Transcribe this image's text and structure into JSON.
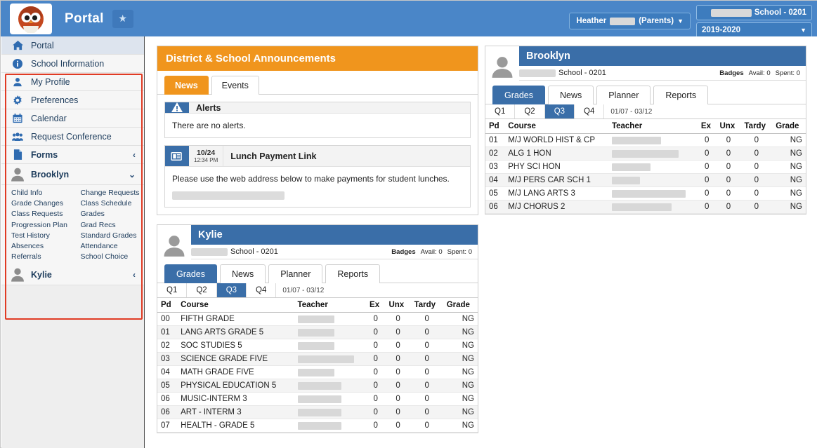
{
  "header": {
    "app_title": "Portal",
    "star_icon": "star-icon",
    "logo_icon": "owl-logo",
    "user_name": "Heather",
    "user_role": "(Parents)",
    "school": "School - 0201",
    "year": "2019-2020",
    "caret": "▼"
  },
  "sidebar": {
    "items": [
      {
        "label": "Portal",
        "icon": "home-icon",
        "active": true
      },
      {
        "label": "School Information",
        "icon": "info-icon",
        "active": false
      },
      {
        "label": "My Profile",
        "icon": "person-icon",
        "active": false
      },
      {
        "label": "Preferences",
        "icon": "gear-icon",
        "active": false
      },
      {
        "label": "Calendar",
        "icon": "calendar-icon",
        "active": false
      },
      {
        "label": "Request Conference",
        "icon": "group-icon",
        "active": false
      },
      {
        "label": "Forms",
        "icon": "document-icon",
        "chevron": "‹"
      }
    ],
    "students": [
      {
        "label": "Brooklyn",
        "icon": "avatar-icon",
        "chevron": "⌄",
        "expanded": true
      },
      {
        "label": "Kylie",
        "icon": "avatar-icon",
        "chevron": "‹",
        "expanded": false
      }
    ],
    "submenu": [
      "Child Info",
      "Change Requests",
      "Grade Changes",
      "Class Schedule",
      "Class Requests",
      "Grades",
      "Progression Plan",
      "Grad Recs",
      "Test History",
      "Standard Grades",
      "Absences",
      "Attendance",
      "Referrals",
      "School Choice"
    ]
  },
  "announcements": {
    "title": "District & School Announcements",
    "tabs": [
      {
        "label": "News",
        "active": true
      },
      {
        "label": "Events",
        "active": false
      }
    ],
    "alerts": {
      "icon": "warning-icon",
      "title": "Alerts",
      "body": "There are no alerts."
    },
    "news_item": {
      "icon": "newspaper-icon",
      "date": "10/24",
      "time": "12:34 PM",
      "title": "Lunch Payment Link",
      "body": "Please use the web address below to make payments for student lunches."
    }
  },
  "students": [
    {
      "name": "Brooklyn",
      "school": "School - 0201",
      "badges_label": "Badges",
      "badges_avail": "Avail: 0",
      "badges_spent": "Spent: 0",
      "tabs": [
        {
          "label": "Grades",
          "active": true
        },
        {
          "label": "News",
          "active": false
        },
        {
          "label": "Planner",
          "active": false
        },
        {
          "label": "Reports",
          "active": false
        }
      ],
      "quarters": [
        {
          "label": "Q1",
          "active": false
        },
        {
          "label": "Q2",
          "active": false
        },
        {
          "label": "Q3",
          "active": true
        },
        {
          "label": "Q4",
          "active": false
        }
      ],
      "date_range": "01/07 - 03/12",
      "columns": [
        "Pd",
        "Course",
        "Teacher",
        "Ex",
        "Unx",
        "Tardy",
        "Grade"
      ],
      "rows": [
        {
          "pd": "01",
          "course": "M/J WORLD HIST & CP",
          "ex": "0",
          "unx": "0",
          "tardy": "0",
          "grade": "NG"
        },
        {
          "pd": "02",
          "course": "ALG 1 HON",
          "ex": "0",
          "unx": "0",
          "tardy": "0",
          "grade": "NG"
        },
        {
          "pd": "03",
          "course": "PHY SCI HON",
          "ex": "0",
          "unx": "0",
          "tardy": "0",
          "grade": "NG"
        },
        {
          "pd": "04",
          "course": "M/J PERS CAR SCH 1",
          "ex": "0",
          "unx": "0",
          "tardy": "0",
          "grade": "NG"
        },
        {
          "pd": "05",
          "course": "M/J LANG ARTS 3",
          "ex": "0",
          "unx": "0",
          "tardy": "0",
          "grade": "NG"
        },
        {
          "pd": "06",
          "course": "M/J CHORUS 2",
          "ex": "0",
          "unx": "0",
          "tardy": "0",
          "grade": "NG"
        }
      ]
    },
    {
      "name": "Kylie",
      "school": "School - 0201",
      "badges_label": "Badges",
      "badges_avail": "Avail: 0",
      "badges_spent": "Spent: 0",
      "tabs": [
        {
          "label": "Grades",
          "active": true
        },
        {
          "label": "News",
          "active": false
        },
        {
          "label": "Planner",
          "active": false
        },
        {
          "label": "Reports",
          "active": false
        }
      ],
      "quarters": [
        {
          "label": "Q1",
          "active": false
        },
        {
          "label": "Q2",
          "active": false
        },
        {
          "label": "Q3",
          "active": true
        },
        {
          "label": "Q4",
          "active": false
        }
      ],
      "date_range": "01/07 - 03/12",
      "columns": [
        "Pd",
        "Course",
        "Teacher",
        "Ex",
        "Unx",
        "Tardy",
        "Grade"
      ],
      "rows": [
        {
          "pd": "00",
          "course": "FIFTH GRADE",
          "ex": "0",
          "unx": "0",
          "tardy": "0",
          "grade": "NG"
        },
        {
          "pd": "01",
          "course": "LANG ARTS GRADE 5",
          "ex": "0",
          "unx": "0",
          "tardy": "0",
          "grade": "NG"
        },
        {
          "pd": "02",
          "course": "SOC STUDIES 5",
          "ex": "0",
          "unx": "0",
          "tardy": "0",
          "grade": "NG"
        },
        {
          "pd": "03",
          "course": "SCIENCE GRADE FIVE",
          "ex": "0",
          "unx": "0",
          "tardy": "0",
          "grade": "NG"
        },
        {
          "pd": "04",
          "course": "MATH GRADE FIVE",
          "ex": "0",
          "unx": "0",
          "tardy": "0",
          "grade": "NG"
        },
        {
          "pd": "05",
          "course": "PHYSICAL EDUCATION 5",
          "ex": "0",
          "unx": "0",
          "tardy": "0",
          "grade": "NG"
        },
        {
          "pd": "06",
          "course": "MUSIC-INTERM 3",
          "ex": "0",
          "unx": "0",
          "tardy": "0",
          "grade": "NG"
        },
        {
          "pd": "06",
          "course": "ART - INTERM 3",
          "ex": "0",
          "unx": "0",
          "tardy": "0",
          "grade": "NG"
        },
        {
          "pd": "07",
          "course": "HEALTH - GRADE 5",
          "ex": "0",
          "unx": "0",
          "tardy": "0",
          "grade": "NG"
        }
      ]
    }
  ],
  "colors": {
    "header_blue": "#4a86c8",
    "card_blue": "#3a6ea8",
    "accent_orange": "#f0951d",
    "link_blue": "#3f7fbf",
    "highlight_red": "#e03b24"
  }
}
